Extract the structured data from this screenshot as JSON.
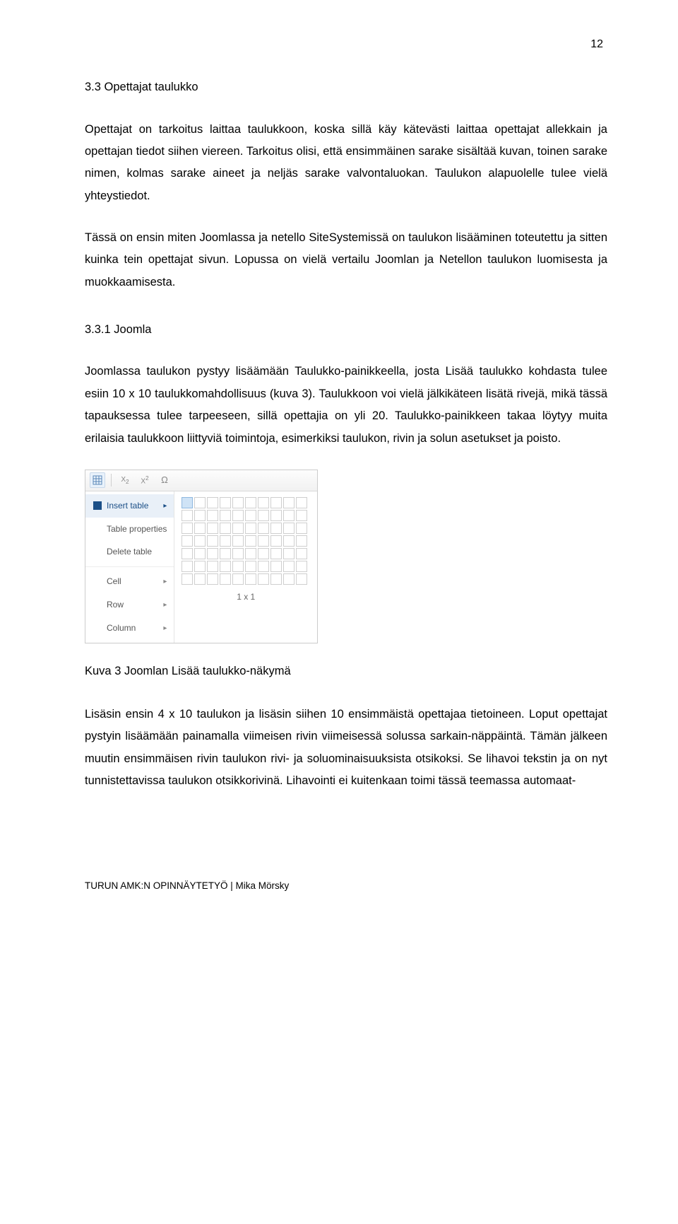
{
  "page_number": "12",
  "heading1": "3.3 Opettajat taulukko",
  "para1": "Opettajat on tarkoitus laittaa taulukkoon, koska sillä käy kätevästi laittaa opettajat allekkain ja opettajan tiedot siihen viereen. Tarkoitus olisi, että ensimmäinen sarake sisältää kuvan, toinen sarake nimen, kolmas sarake aineet ja neljäs sarake valvontaluokan. Taulukon alapuolelle tulee vielä yhteystiedot.",
  "para2": "Tässä on ensin miten Joomlassa ja netello SiteSystemissä on taulukon lisääminen toteutettu ja sitten kuinka tein opettajat sivun. Lopussa on vielä vertailu Joomlan ja Netellon taulukon luomisesta ja muokkaamisesta.",
  "heading2": "3.3.1 Joomla",
  "para3": "Joomlassa taulukon pystyy lisäämään Taulukko-painikkeella, josta Lisää taulukko kohdasta tulee esiin 10 x 10 taulukkomahdollisuus (kuva 3). Taulukkoon voi vielä jälkikäteen lisätä rivejä, mikä tässä tapauksessa tulee tarpeeseen, sillä opettajia on yli 20. Taulukko-painikkeen takaa löytyy muita erilaisia taulukkoon liittyviä toimintoja, esimerkiksi taulukon, rivin ja solun asetukset ja poisto.",
  "editor": {
    "menu": {
      "insert_table": "Insert table",
      "table_properties": "Table properties",
      "delete_table": "Delete table",
      "cell": "Cell",
      "row": "Row",
      "column": "Column"
    },
    "grid_caption": "1 x 1"
  },
  "figure_caption": "Kuva 3 Joomlan Lisää taulukko-näkymä",
  "para4": "Lisäsin ensin 4 x 10 taulukon ja lisäsin siihen 10 ensimmäistä opettajaa tietoineen. Loput opettajat pystyin lisäämään painamalla viimeisen rivin viimeisessä solussa sarkain-näppäintä. Tämän jälkeen muutin ensimmäisen rivin taulukon rivi- ja soluominaisuuksista otsikoksi. Se lihavoi tekstin ja on nyt tunnistettavissa taulukon otsikkorivinä. Lihavointi ei kuitenkaan toimi tässä teemassa automaat-",
  "footer": "TURUN AMK:N OPINNÄYTETYÖ | Mika Mörsky"
}
